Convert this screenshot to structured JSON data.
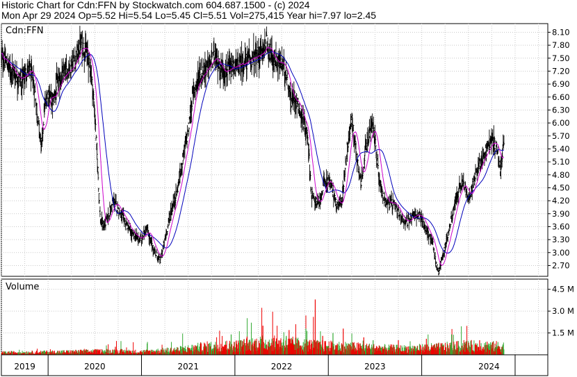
{
  "header": {
    "line1": "Historic Chart for Cdn:FFN by Stockwatch.com 604.687.1500 - (c) 2024",
    "line2": "Mon Apr 29 2024  Op=5.52  Hi=5.54  Lo=5.45  Cl=5.51  Vol=275,415  Year hi=7.97  lo=2.45"
  },
  "chart_data": {
    "type": "line",
    "symbol_label": "Cdn:FFN",
    "volume_label": "Volume",
    "price_ylim": [
      2.45,
      8.3
    ],
    "price_ticks": [
      8.1,
      7.8,
      7.5,
      7.2,
      6.9,
      6.6,
      6.3,
      6.0,
      5.7,
      5.4,
      5.1,
      4.8,
      4.5,
      4.2,
      3.9,
      3.6,
      3.3,
      3.0,
      2.7
    ],
    "price_tick_labels": [
      "8.10",
      "7.80",
      "7.50",
      "7.20",
      "6.90",
      "6.60",
      "6.30",
      "6.00",
      "5.70",
      "5.40",
      "5.10",
      "4.80",
      "4.50",
      "4.20",
      "3.90",
      "3.60",
      "3.30",
      "3.00",
      "2.70"
    ],
    "volume_ylim": [
      0,
      5.2
    ],
    "volume_ticks": [
      4.5,
      3.0,
      1.5
    ],
    "volume_tick_labels": [
      "4.5 M",
      "3.0 M",
      "1.5 M"
    ],
    "x_range": [
      2018.5,
      2024.35
    ],
    "year_boundaries": [
      2019,
      2020,
      2021,
      2022,
      2023,
      2024
    ],
    "year_labels": [
      {
        "label": "2019",
        "x": 2018.75
      },
      {
        "label": "2020",
        "x": 2019.5
      },
      {
        "label": "2021",
        "x": 2020.5
      },
      {
        "label": "2022",
        "x": 2021.5
      },
      {
        "label": "2023",
        "x": 2022.5
      },
      {
        "label": "2024",
        "x": 2023.72
      }
    ],
    "price_anchors": [
      [
        2018.5,
        7.55
      ],
      [
        2018.6,
        7.25
      ],
      [
        2018.7,
        7.0
      ],
      [
        2018.8,
        7.25
      ],
      [
        2018.85,
        6.9
      ],
      [
        2018.9,
        5.9
      ],
      [
        2018.93,
        5.4
      ],
      [
        2018.96,
        6.3
      ],
      [
        2019.0,
        6.7
      ],
      [
        2019.05,
        6.5
      ],
      [
        2019.1,
        6.9
      ],
      [
        2019.2,
        7.2
      ],
      [
        2019.3,
        7.5
      ],
      [
        2019.35,
        7.85
      ],
      [
        2019.42,
        7.6
      ],
      [
        2019.46,
        7.2
      ],
      [
        2019.5,
        6.2
      ],
      [
        2019.53,
        5.0
      ],
      [
        2019.56,
        3.7
      ],
      [
        2019.6,
        3.6
      ],
      [
        2019.7,
        4.2
      ],
      [
        2019.8,
        3.8
      ],
      [
        2019.9,
        3.4
      ],
      [
        2020.0,
        3.3
      ],
      [
        2020.05,
        3.6
      ],
      [
        2020.12,
        3.1
      ],
      [
        2020.2,
        2.8
      ],
      [
        2020.25,
        3.3
      ],
      [
        2020.32,
        4.0
      ],
      [
        2020.38,
        4.4
      ],
      [
        2020.45,
        5.3
      ],
      [
        2020.5,
        5.8
      ],
      [
        2020.55,
        6.7
      ],
      [
        2020.62,
        7.1
      ],
      [
        2020.7,
        7.3
      ],
      [
        2020.78,
        7.5
      ],
      [
        2020.85,
        7.25
      ],
      [
        2020.92,
        7.2
      ],
      [
        2021.0,
        7.3
      ],
      [
        2021.1,
        7.4
      ],
      [
        2021.2,
        7.5
      ],
      [
        2021.3,
        7.65
      ],
      [
        2021.33,
        7.9
      ],
      [
        2021.4,
        7.5
      ],
      [
        2021.5,
        7.35
      ],
      [
        2021.55,
        7.2
      ],
      [
        2021.6,
        6.5
      ],
      [
        2021.65,
        6.6
      ],
      [
        2021.72,
        6.1
      ],
      [
        2021.78,
        5.7
      ],
      [
        2021.82,
        4.3
      ],
      [
        2021.9,
        4.1
      ],
      [
        2021.95,
        4.6
      ],
      [
        2022.0,
        4.7
      ],
      [
        2022.05,
        4.4
      ],
      [
        2022.1,
        4.0
      ],
      [
        2022.15,
        4.3
      ],
      [
        2022.2,
        5.4
      ],
      [
        2022.25,
        6.1
      ],
      [
        2022.3,
        5.3
      ],
      [
        2022.35,
        4.6
      ],
      [
        2022.4,
        5.4
      ],
      [
        2022.47,
        6.0
      ],
      [
        2022.5,
        5.6
      ],
      [
        2022.55,
        4.6
      ],
      [
        2022.6,
        4.2
      ],
      [
        2022.7,
        4.1
      ],
      [
        2022.78,
        3.8
      ],
      [
        2022.85,
        3.7
      ],
      [
        2022.9,
        3.9
      ],
      [
        2023.0,
        3.8
      ],
      [
        2023.05,
        3.5
      ],
      [
        2023.12,
        3.2
      ],
      [
        2023.15,
        2.75
      ],
      [
        2023.18,
        2.55
      ],
      [
        2023.22,
        2.9
      ],
      [
        2023.28,
        3.4
      ],
      [
        2023.32,
        3.8
      ],
      [
        2023.4,
        4.5
      ],
      [
        2023.45,
        4.6
      ],
      [
        2023.5,
        4.2
      ],
      [
        2023.55,
        4.6
      ],
      [
        2023.62,
        5.1
      ],
      [
        2023.7,
        5.4
      ],
      [
        2023.75,
        5.6
      ],
      [
        2023.8,
        5.45
      ],
      [
        2023.84,
        4.9
      ],
      [
        2023.88,
        5.51
      ]
    ],
    "volume_anchors": [
      [
        2018.5,
        0.15
      ],
      [
        2019.0,
        0.18
      ],
      [
        2019.4,
        0.22
      ],
      [
        2019.7,
        0.25
      ],
      [
        2020.0,
        0.2
      ],
      [
        2020.4,
        0.35
      ],
      [
        2020.7,
        0.55
      ],
      [
        2021.0,
        0.6
      ],
      [
        2021.3,
        0.8
      ],
      [
        2021.6,
        0.75
      ],
      [
        2021.9,
        0.6
      ],
      [
        2022.2,
        0.55
      ],
      [
        2022.5,
        0.45
      ],
      [
        2022.8,
        0.4
      ],
      [
        2023.0,
        0.45
      ],
      [
        2023.2,
        0.5
      ],
      [
        2023.5,
        0.6
      ],
      [
        2023.88,
        0.55
      ]
    ],
    "volume_spikes": [
      [
        2019.72,
        0.55
      ],
      [
        2020.96,
        1.4
      ],
      [
        2021.13,
        1.25
      ],
      [
        2021.3,
        2.0
      ],
      [
        2021.55,
        1.3
      ],
      [
        2021.58,
        1.7
      ],
      [
        2021.62,
        1.0
      ],
      [
        2021.76,
        1.8
      ],
      [
        2021.86,
        3.8
      ],
      [
        2021.94,
        1.3
      ],
      [
        2022.05,
        1.5
      ],
      [
        2022.16,
        1.8
      ],
      [
        2022.38,
        1.2
      ],
      [
        2022.48,
        1.0
      ],
      [
        2022.75,
        1.0
      ],
      [
        2023.05,
        1.1
      ],
      [
        2023.32,
        1.4
      ],
      [
        2023.62,
        1.0
      ],
      [
        2023.7,
        0.9
      ],
      [
        2023.8,
        0.7
      ]
    ],
    "series": [
      {
        "name": "Price",
        "color": "#000000",
        "role": "daily-bars"
      },
      {
        "name": "",
        "color": "#cc00cc",
        "role": "short-moving-average"
      },
      {
        "name": "",
        "color": "#0000bb",
        "role": "long-moving-average"
      }
    ],
    "volume_colors": {
      "up": "#33aa33",
      "down": "#ee0000"
    },
    "grid": true,
    "legend": "none"
  }
}
